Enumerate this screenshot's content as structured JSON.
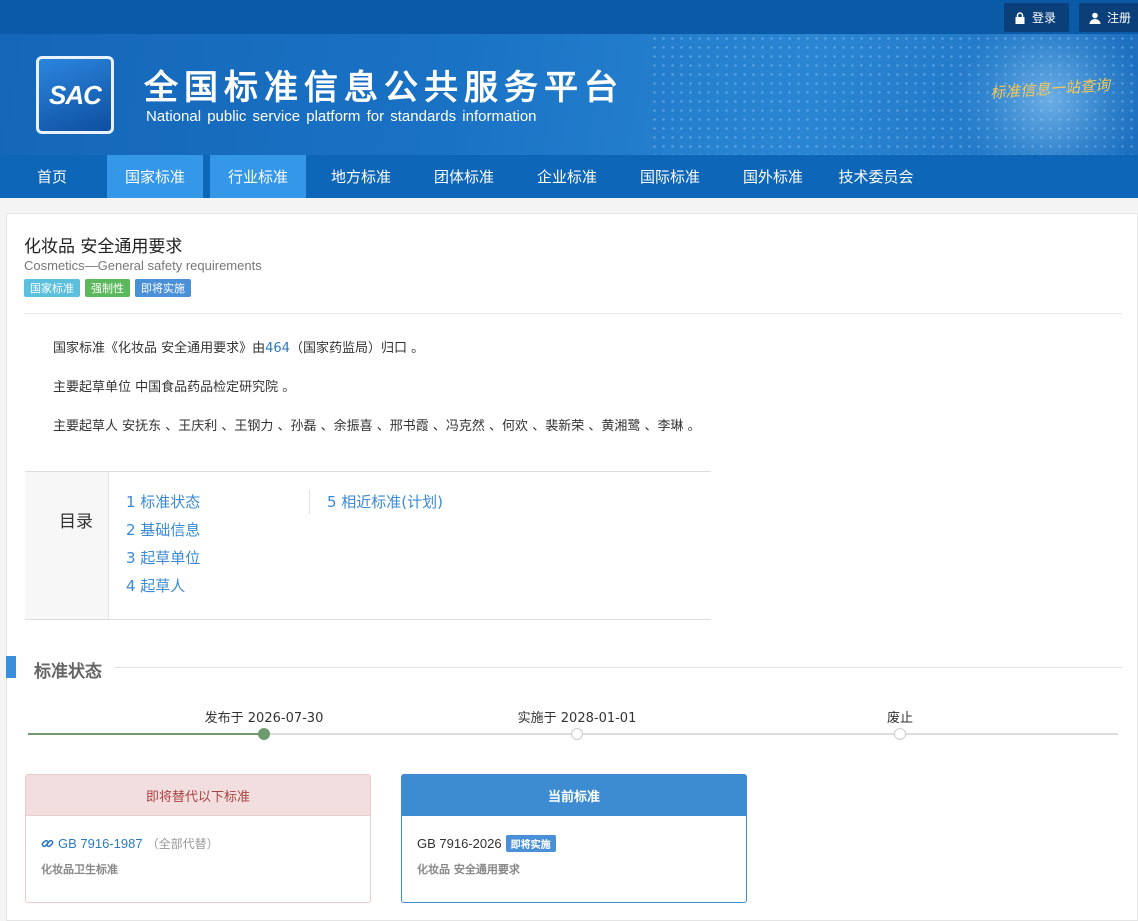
{
  "topbar": {
    "login_label": "登录",
    "register_label": "注册"
  },
  "header": {
    "logo_text": "SAC",
    "site_title": "全国标准信息公共服务平台",
    "site_subtitle": "National public service platform  for standards information",
    "slogan": "标准信息一站查询"
  },
  "nav": {
    "items": [
      {
        "label": "首页"
      },
      {
        "label": "国家标准"
      },
      {
        "label": "行业标准"
      },
      {
        "label": "地方标准"
      },
      {
        "label": "团体标准"
      },
      {
        "label": "企业标准"
      },
      {
        "label": "国际标准"
      },
      {
        "label": "国外标准"
      },
      {
        "label": "技术委员会"
      }
    ]
  },
  "standard": {
    "title_cn": "化妆品 安全通用要求",
    "title_en": "Cosmetics—General safety requirements",
    "tags": [
      "国家标准",
      "强制性",
      "即将实施"
    ],
    "desc1_prefix": "国家标准《化妆品 安全通用要求》由",
    "desc1_link": "464",
    "desc1_suffix": "（国家药监局）归口 。",
    "desc2": "主要起草单位 中国食品药品检定研究院 。",
    "desc3": "主要起草人 安抚东 、王庆利 、王钢力 、孙磊 、余振喜 、邢书霞 、冯克然 、何欢 、裴新荣 、黄湘鹭 、李琳 。"
  },
  "toc": {
    "label": "目录",
    "items": [
      "1  标准状态",
      "2  基础信息",
      "3  起草单位",
      "4  起草人",
      "5  相近标准(计划)"
    ]
  },
  "status_section": {
    "title": "标准状态",
    "timeline": [
      {
        "label": "发布于 2026-07-30",
        "done": true
      },
      {
        "label": "实施于 2028-01-01",
        "done": false
      },
      {
        "label": "废止",
        "done": false
      }
    ]
  },
  "cards": {
    "replace": {
      "header": "即将替代以下标准",
      "code": "GB 7916-1987",
      "note": "（全部代替）",
      "name": "化妆品卫生标准"
    },
    "current": {
      "header": "当前标准",
      "code": "GB 7916-2026",
      "badge": "即将实施",
      "name": "化妆品 安全通用要求"
    }
  },
  "colors": {
    "nav_bg": "#0e66b9",
    "nav_active": "#3597e8",
    "link": "#2a7ac4",
    "timeline_done": "#6f9a6f"
  }
}
